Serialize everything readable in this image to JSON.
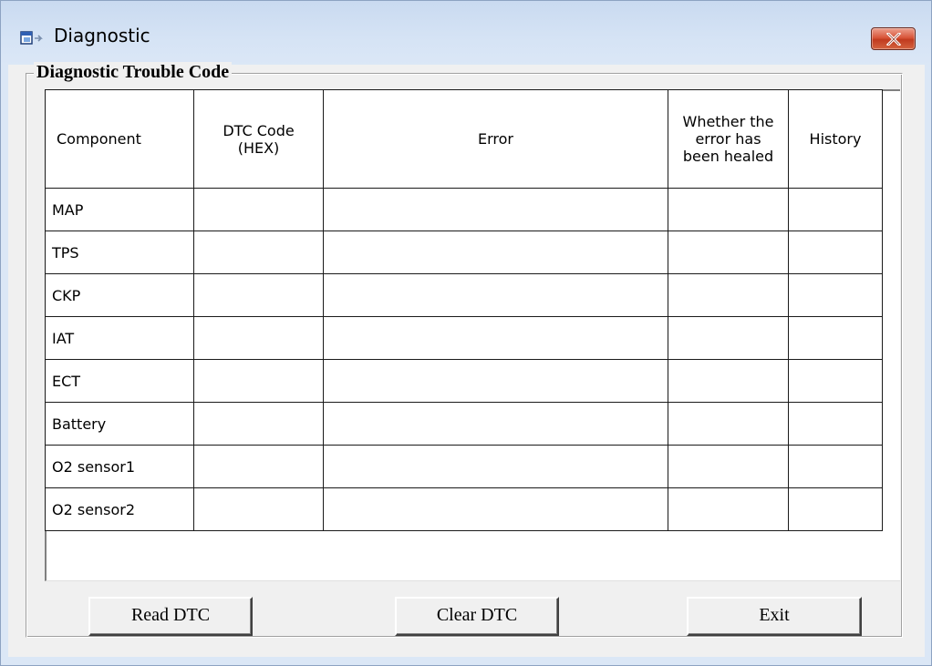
{
  "window": {
    "title": "Diagnostic"
  },
  "group": {
    "title": "Diagnostic Trouble Code"
  },
  "table": {
    "headers": [
      {
        "lines": [
          "Component"
        ]
      },
      {
        "lines": [
          "DTC Code",
          "(HEX)"
        ]
      },
      {
        "lines": [
          "Error"
        ]
      },
      {
        "lines": [
          "Whether the",
          "error has",
          "been healed"
        ]
      },
      {
        "lines": [
          "History"
        ]
      }
    ],
    "rows": [
      {
        "component": "MAP",
        "dtc_code": "",
        "error": "",
        "healed": "",
        "history": ""
      },
      {
        "component": "TPS",
        "dtc_code": "",
        "error": "",
        "healed": "",
        "history": ""
      },
      {
        "component": "CKP",
        "dtc_code": "",
        "error": "",
        "healed": "",
        "history": ""
      },
      {
        "component": "IAT",
        "dtc_code": "",
        "error": "",
        "healed": "",
        "history": ""
      },
      {
        "component": "ECT",
        "dtc_code": "",
        "error": "",
        "healed": "",
        "history": ""
      },
      {
        "component": "Battery",
        "dtc_code": "",
        "error": "",
        "healed": "",
        "history": ""
      },
      {
        "component": "O2 sensor1",
        "dtc_code": "",
        "error": "",
        "healed": "",
        "history": ""
      },
      {
        "component": "O2 sensor2",
        "dtc_code": "",
        "error": "",
        "healed": "",
        "history": ""
      }
    ]
  },
  "buttons": {
    "read_dtc": "Read DTC",
    "clear_dtc": "Clear DTC",
    "exit": "Exit"
  },
  "icons": {
    "app": "window-app-icon",
    "close": "close-icon"
  },
  "colors": {
    "titlebar": "#dbe7f6",
    "close_button": "#c8462b",
    "dialog_face": "#f0f0f0"
  }
}
